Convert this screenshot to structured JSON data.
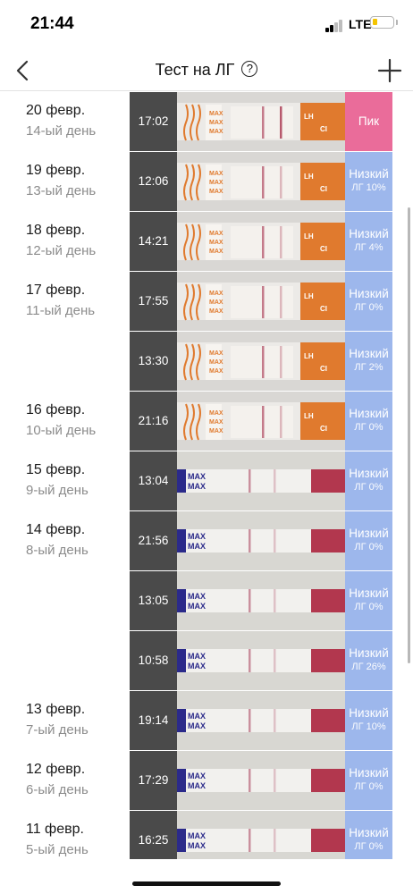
{
  "status": {
    "time": "21:44",
    "network": "LTE"
  },
  "nav": {
    "title": "Тест на ЛГ",
    "help_icon": "?",
    "back_icon": "chevron-left-icon",
    "add_icon": "plus-icon"
  },
  "colors": {
    "peak": "#ea6c9a",
    "low": "#9db7ec",
    "time_bg": "#4a4a4a"
  },
  "rows": [
    {
      "date": "20 февр.",
      "day": "14-ый день",
      "time": "17:02",
      "result": "Пик",
      "value": "",
      "kind": "peak",
      "brand": "orange"
    },
    {
      "date": "19 февр.",
      "day": "13-ый день",
      "time": "12:06",
      "result": "Низкий",
      "value": "ЛГ 10%",
      "kind": "low",
      "brand": "orange"
    },
    {
      "date": "18 февр.",
      "day": "12-ый день",
      "time": "14:21",
      "result": "Низкий",
      "value": "ЛГ 4%",
      "kind": "low",
      "brand": "orange"
    },
    {
      "date": "17 февр.",
      "day": "11-ый день",
      "time": "17:55",
      "result": "Низкий",
      "value": "ЛГ 0%",
      "kind": "low",
      "brand": "orange"
    },
    {
      "date": "",
      "day": "",
      "time": "13:30",
      "result": "Низкий",
      "value": "ЛГ 2%",
      "kind": "low",
      "brand": "orange"
    },
    {
      "date": "16 февр.",
      "day": "10-ый день",
      "time": "21:16",
      "result": "Низкий",
      "value": "ЛГ 0%",
      "kind": "low",
      "brand": "orange"
    },
    {
      "date": "15 февр.",
      "day": "9-ый день",
      "time": "13:04",
      "result": "Низкий",
      "value": "ЛГ 0%",
      "kind": "low",
      "brand": "blue"
    },
    {
      "date": "14 февр.",
      "day": "8-ый день",
      "time": "21:56",
      "result": "Низкий",
      "value": "ЛГ 0%",
      "kind": "low",
      "brand": "blue"
    },
    {
      "date": "",
      "day": "",
      "time": "13:05",
      "result": "Низкий",
      "value": "ЛГ 0%",
      "kind": "low",
      "brand": "blue"
    },
    {
      "date": "",
      "day": "",
      "time": "10:58",
      "result": "Низкий",
      "value": "ЛГ 26%",
      "kind": "low",
      "brand": "blue"
    },
    {
      "date": "13 февр.",
      "day": "7-ый день",
      "time": "19:14",
      "result": "Низкий",
      "value": "ЛГ 10%",
      "kind": "low",
      "brand": "blue"
    },
    {
      "date": "12 февр.",
      "day": "6-ый день",
      "time": "17:29",
      "result": "Низкий",
      "value": "ЛГ 0%",
      "kind": "low",
      "brand": "blue"
    },
    {
      "date": "11 февр.",
      "day": "5-ый день",
      "time": "16:25",
      "result": "Низкий",
      "value": "ЛГ 0%",
      "kind": "low",
      "brand": "blue"
    }
  ]
}
